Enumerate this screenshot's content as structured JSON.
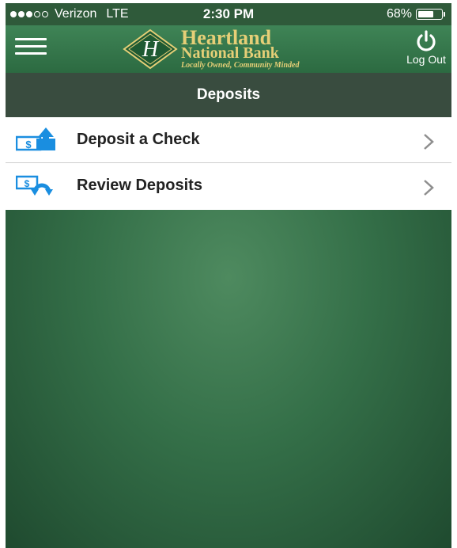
{
  "status_bar": {
    "carrier": "Verizon",
    "network": "LTE",
    "time": "2:30 PM",
    "battery_percent": "68%",
    "battery_level": 0.68,
    "signal_bars_filled": 3,
    "signal_bars_total": 5
  },
  "header": {
    "menu_icon": "hamburger-menu-icon",
    "brand": {
      "name_line1": "Heartland",
      "name_line2": "National Bank",
      "tagline": "Locally Owned, Community Minded",
      "emblem_letter": "H"
    },
    "logout_label": "Log Out",
    "logout_icon": "power-icon"
  },
  "page": {
    "title": "Deposits"
  },
  "menu": {
    "items": [
      {
        "label": "Deposit a Check",
        "icon": "deposit-check-icon"
      },
      {
        "label": "Review Deposits",
        "icon": "review-deposits-icon"
      }
    ]
  },
  "colors": {
    "header_green": "#3a7b4f",
    "title_bar": "#394c3f",
    "brand_gold": "#e6cf77",
    "icon_blue": "#1a8ee0",
    "background_green": "#2f6a44"
  }
}
